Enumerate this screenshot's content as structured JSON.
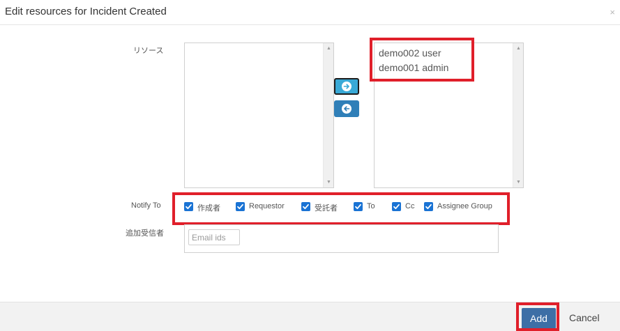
{
  "dialog": {
    "title": "Edit resources for Incident Created",
    "close_glyph": "×"
  },
  "resources": {
    "label": "リソース",
    "available": [],
    "selected": [
      "demo002 user",
      "demo001 admin"
    ],
    "move_right_icon": "arrow-right-circle-icon",
    "move_left_icon": "arrow-left-circle-icon",
    "scroll_up_glyph": "▲",
    "scroll_down_glyph": "▼"
  },
  "notify": {
    "label": "Notify To",
    "options": [
      {
        "label": "作成者",
        "checked": true
      },
      {
        "label": "Requestor",
        "checked": true
      },
      {
        "label": "受託者",
        "checked": true
      },
      {
        "label": "To",
        "checked": true
      },
      {
        "label": "Cc",
        "checked": true
      },
      {
        "label": "Assignee Group",
        "checked": true
      }
    ]
  },
  "additional": {
    "label": "追加受信者",
    "placeholder": "Email ids",
    "value": ""
  },
  "footer": {
    "add_label": "Add",
    "cancel_label": "Cancel"
  },
  "colors": {
    "highlight": "#e01f2a",
    "primary_button": "#3d6fa6",
    "checkbox": "#1a73d4",
    "move_button": "#2f7fb8",
    "move_button_active": "#39a9d6"
  }
}
